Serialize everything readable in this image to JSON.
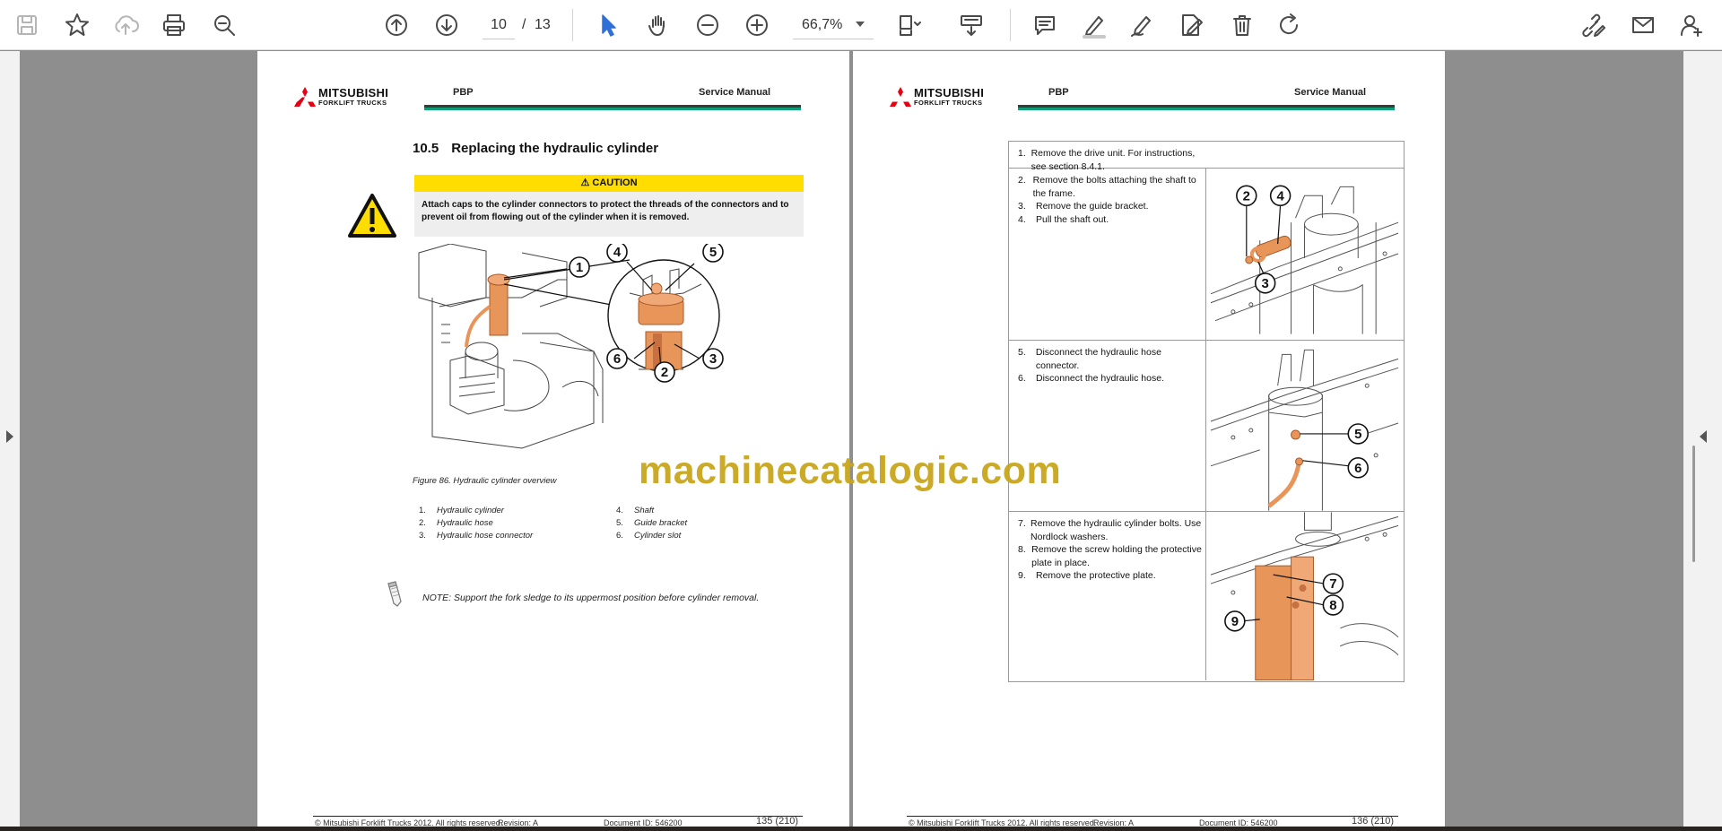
{
  "toolbar": {
    "page_current": "10",
    "page_separator": "/",
    "page_total": "13",
    "zoom": "66,7%"
  },
  "left_page": {
    "logo_main": "MITSUBISHI",
    "logo_sub": "FORKLIFT TRUCKS",
    "header_product": "PBP",
    "header_doc": "Service Manual",
    "section_number": "10.5",
    "section_title": "Replacing the hydraulic cylinder",
    "caution_label": "CAUTION",
    "caution_text": "Attach caps to the cylinder connectors to protect the threads of the connectors and to prevent oil from flowing out of the cylinder when it is removed.",
    "callouts": [
      "1",
      "2",
      "3",
      "4",
      "5",
      "6"
    ],
    "figure_caption": "Figure 86. Hydraulic cylinder overview",
    "legend": [
      {
        "n": "1.",
        "label": "Hydraulic cylinder"
      },
      {
        "n": "2.",
        "label": "Hydraulic hose"
      },
      {
        "n": "3.",
        "label": "Hydraulic hose connector"
      },
      {
        "n": "4.",
        "label": "Shaft"
      },
      {
        "n": "5.",
        "label": "Guide bracket"
      },
      {
        "n": "6.",
        "label": "Cylinder slot"
      }
    ],
    "note": "NOTE: Support the fork sledge to its uppermost position before cylinder removal.",
    "footer_copyright": "© Mitsubishi Forklift Trucks 2012. All rights reserved.",
    "footer_revision": "Revision: A",
    "footer_docid": "Document ID: 546200",
    "footer_page": "135 (210)"
  },
  "right_page": {
    "logo_main": "MITSUBISHI",
    "logo_sub": "FORKLIFT TRUCKS",
    "header_product": "PBP",
    "header_doc": "Service Manual",
    "steps_row1": [
      {
        "n": "1.",
        "text": "Remove the drive unit. For instructions, see section 8.4.1."
      }
    ],
    "steps_row2": [
      {
        "n": "2.",
        "text": "Remove the bolts attaching the shaft to the frame."
      },
      {
        "n": "3.",
        "text": "Remove the guide bracket."
      },
      {
        "n": "4.",
        "text": "Pull the shaft out."
      }
    ],
    "steps_row3": [
      {
        "n": "5.",
        "text": "Disconnect the hydraulic hose connector."
      },
      {
        "n": "6.",
        "text": "Disconnect the hydraulic hose."
      }
    ],
    "steps_row4": [
      {
        "n": "7.",
        "text": "Remove the hydraulic cylinder bolts. Use Nordlock washers."
      },
      {
        "n": "8.",
        "text": "Remove the screw holding the protective plate in place."
      },
      {
        "n": "9.",
        "text": "Remove the protective plate."
      }
    ],
    "callouts_row2": [
      "2",
      "4",
      "3"
    ],
    "callouts_row3": [
      "5",
      "6"
    ],
    "callouts_row4": [
      "7",
      "8",
      "9"
    ],
    "footer_copyright": "© Mitsubishi Forklift Trucks 2012. All rights reserved.",
    "footer_revision": "Revision: A",
    "footer_docid": "Document ID: 546200",
    "footer_page": "136 (210)"
  },
  "watermark": "machinecatalogic.com",
  "colors": {
    "accent_blue": "#2e6fd8",
    "caution_yellow": "#ffdd00",
    "header_green": "#0f9d76",
    "part_orange": "#e8955a",
    "logo_red": "#e60012",
    "watermark": "#c9a61c"
  }
}
